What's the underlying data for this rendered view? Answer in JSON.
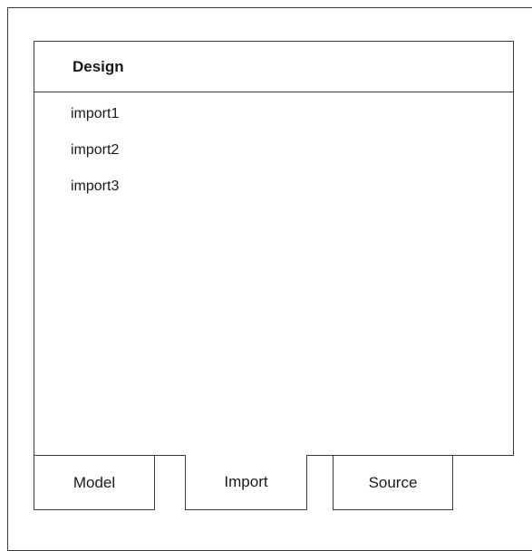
{
  "panel": {
    "title": "Design",
    "items": [
      {
        "label": "import1"
      },
      {
        "label": "import2"
      },
      {
        "label": "import3"
      }
    ]
  },
  "tabs": [
    {
      "label": "Model",
      "active": false
    },
    {
      "label": "Import",
      "active": true
    },
    {
      "label": "Source",
      "active": false
    }
  ]
}
